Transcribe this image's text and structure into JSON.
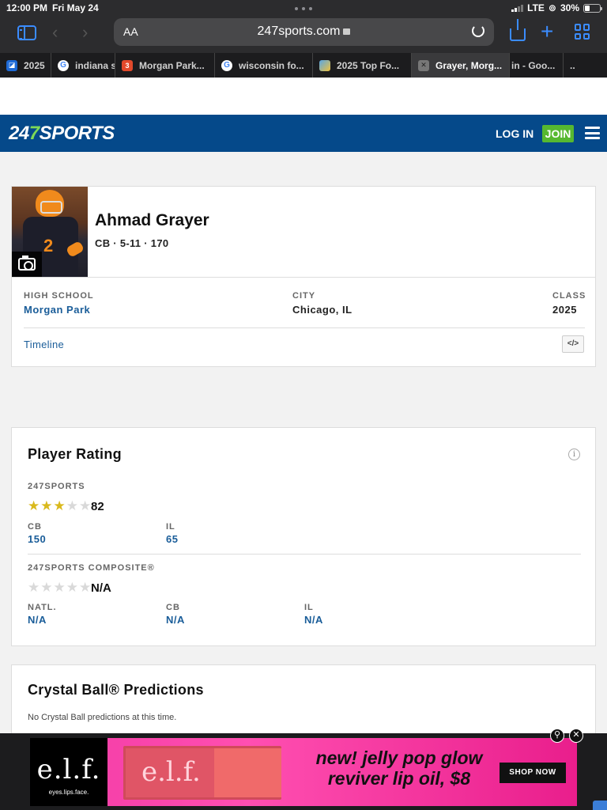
{
  "status": {
    "time": "12:00 PM",
    "date": "Fri May 24",
    "network": "LTE",
    "battery": "30%"
  },
  "browser": {
    "aa_label": "AA",
    "url": "247sports.com",
    "tabs": [
      {
        "label": "2025",
        "favicon": "blue-icon"
      },
      {
        "label": "indiana s",
        "favicon": "google-icon"
      },
      {
        "label": "Morgan Park...",
        "favicon": "red-icon"
      },
      {
        "label": "wisconsin fo...",
        "favicon": "google-icon"
      },
      {
        "label": "2025 Top Fo...",
        "favicon": "image-icon"
      },
      {
        "label": "Grayer, Morg...",
        "favicon": "close-icon",
        "active": true
      },
      {
        "label": "in - Goo...",
        "favicon": ""
      },
      {
        "label": "..",
        "favicon": ""
      }
    ]
  },
  "header": {
    "logo_num_a": "24",
    "logo_num_b": "7",
    "logo_word": "SPORTS",
    "login": "LOG IN",
    "join": "JOIN",
    "brand_color": "#05498a",
    "join_color": "#56b830"
  },
  "player": {
    "name": "Ahmad Grayer",
    "meta": "CB · 5-11 · 170",
    "jersey_number": "2",
    "high_school_label": "HIGH SCHOOL",
    "high_school": "Morgan Park",
    "city_label": "CITY",
    "city": "Chicago, IL",
    "class_label": "CLASS",
    "class": "2025",
    "timeline": "Timeline",
    "embed_icon": "</>"
  },
  "rating": {
    "title": "Player Rating",
    "info_icon": "i",
    "s247": {
      "label": "247SPORTS",
      "stars": 3,
      "score": "82",
      "pos_label": "CB",
      "pos_rank": "150",
      "state_label": "IL",
      "state_rank": "65"
    },
    "composite": {
      "label": "247SPORTS COMPOSITE®",
      "stars": 0,
      "score": "N/A",
      "natl_label": "NATL.",
      "natl": "N/A",
      "pos_label": "CB",
      "pos": "N/A",
      "state_label": "IL",
      "state": "N/A"
    }
  },
  "crystal_ball": {
    "title": "Crystal Ball® Predictions",
    "note": "No Crystal Ball predictions at this time."
  },
  "ad": {
    "brand": "e.l.f.",
    "tagline": "eyes.lips.face.",
    "product_brand": "e.l.f.",
    "headline": "new! jelly pop glow reviver lip oil, $8",
    "cta": "SHOP NOW",
    "close_icon": "✕",
    "info_icon": "⚲"
  }
}
